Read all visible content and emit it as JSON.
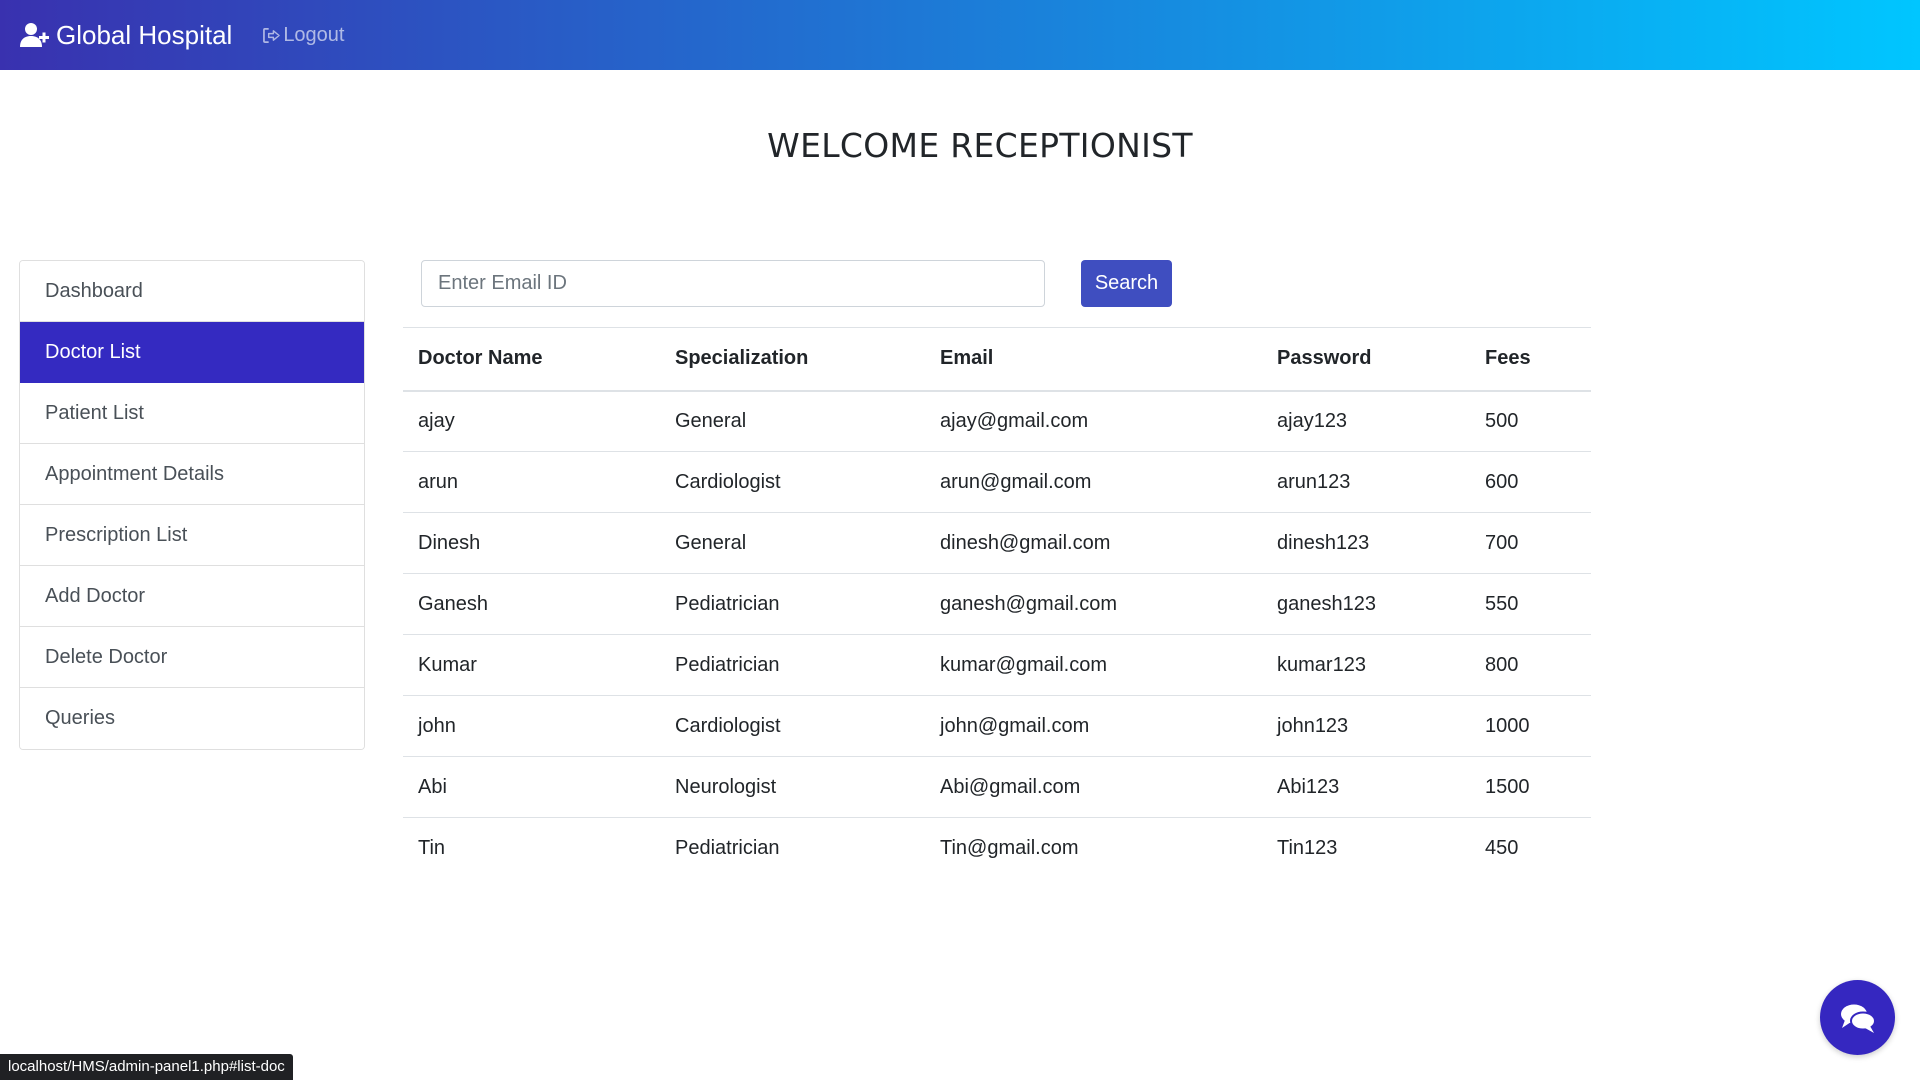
{
  "brand": {
    "name": "Global Hospital",
    "icon": "user-plus-icon"
  },
  "nav": {
    "logout_label": "Logout",
    "logout_icon": "sign-out-icon"
  },
  "welcome": "WELCOME RECEPTIONIST",
  "sidebar": {
    "active": "Doctor List",
    "items": [
      {
        "label": "Dashboard"
      },
      {
        "label": "Doctor List"
      },
      {
        "label": "Patient List"
      },
      {
        "label": "Appointment Details"
      },
      {
        "label": "Prescription List"
      },
      {
        "label": "Add Doctor"
      },
      {
        "label": "Delete Doctor"
      },
      {
        "label": "Queries"
      }
    ]
  },
  "search": {
    "placeholder": "Enter Email ID",
    "value": "",
    "button_label": "Search"
  },
  "table": {
    "headers": [
      "Doctor Name",
      "Specialization",
      "Email",
      "Password",
      "Fees"
    ],
    "rows": [
      [
        "ajay",
        "General",
        "ajay@gmail.com",
        "ajay123",
        "500"
      ],
      [
        "arun",
        "Cardiologist",
        "arun@gmail.com",
        "arun123",
        "600"
      ],
      [
        "Dinesh",
        "General",
        "dinesh@gmail.com",
        "dinesh123",
        "700"
      ],
      [
        "Ganesh",
        "Pediatrician",
        "ganesh@gmail.com",
        "ganesh123",
        "550"
      ],
      [
        "Kumar",
        "Pediatrician",
        "kumar@gmail.com",
        "kumar123",
        "800"
      ],
      [
        "john",
        "Cardiologist",
        "john@gmail.com",
        "john123",
        "1000"
      ],
      [
        "Abi",
        "Neurologist",
        "Abi@gmail.com",
        "Abi123",
        "1500"
      ],
      [
        "Tin",
        "Pediatrician",
        "Tin@gmail.com",
        "Tin123",
        "450"
      ]
    ]
  },
  "chat": {
    "icon": "comments-icon"
  },
  "status_bar": {
    "url": "localhost/HMS/admin-panel1.php#list-doc"
  },
  "colors": {
    "navbar_gradient_start": "#3931af",
    "navbar_gradient_end": "#00c6ff",
    "sidebar_active": "#342ac1",
    "search_button": "#3f4ec0",
    "chat_button": "#3527c0"
  }
}
